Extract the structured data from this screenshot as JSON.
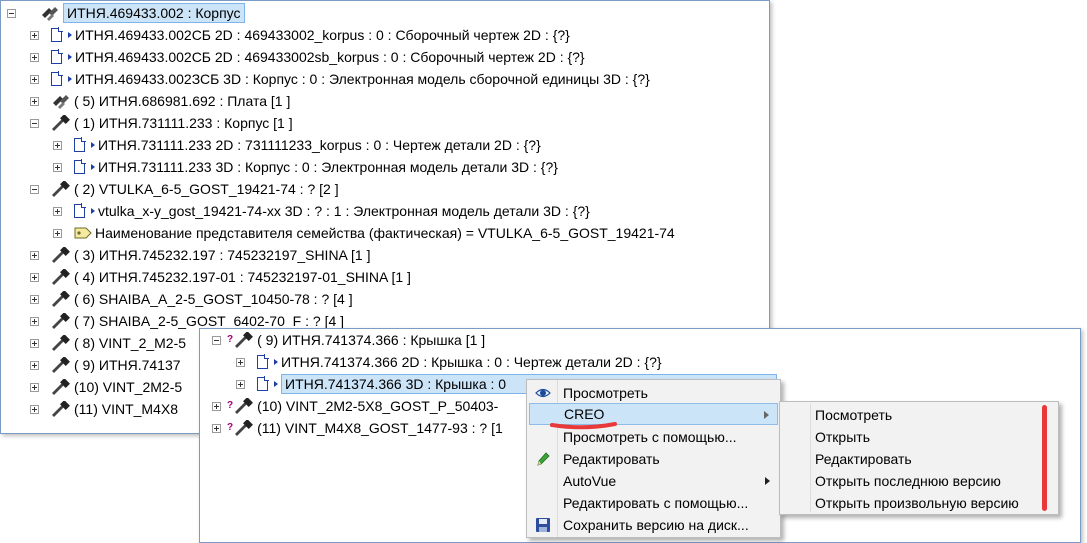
{
  "tree_main": {
    "rows": [
      {
        "text": "ИТНЯ.469433.002 : Корпус"
      },
      {
        "text": "ИТНЯ.469433.002СБ 2D : 469433002_korpus : 0 : Сборочный чертеж 2D : {?}"
      },
      {
        "text": "ИТНЯ.469433.002СБ 2D : 469433002sb_korpus : 0 : Сборочный чертеж 2D : {?}"
      },
      {
        "text": "ИТНЯ.469433.002ЗСБ 3D : Корпус : 0 : Электронная модель сборочной единицы 3D : {?}"
      },
      {
        "text": "( 5) ИТНЯ.686981.692 : Плата [1 ]"
      },
      {
        "text": "( 1) ИТНЯ.731111.233 : Корпус [1 ]"
      },
      {
        "text": "ИТНЯ.731111.233 2D : 731111233_korpus : 0 : Чертеж детали 2D : {?}"
      },
      {
        "text": "ИТНЯ.731111.233 3D : Корпус : 0 : Электронная модель детали 3D : {?}"
      },
      {
        "text": "( 2) VTULKA_6-5_GOST_19421-74 : ? [2 ]"
      },
      {
        "text": "vtulka_x-y_gost_19421-74-xx 3D : ? : 1 : Электронная модель детали 3D : {?}"
      },
      {
        "text": "Наименование представителя семейства (фактическая) = VTULKA_6-5_GOST_19421-74"
      },
      {
        "text": "( 3) ИТНЯ.745232.197 : 745232197_SHINA [1 ]"
      },
      {
        "text": "( 4) ИТНЯ.745232.197-01 : 745232197-01_SHINA [1 ]"
      },
      {
        "text": "( 6) SHAIBA_A_2-5_GOST_10450-78 : ? [4 ]"
      },
      {
        "text": "( 7) SHAIBA_2-5_GOST_6402-70_F : ? [4 ]"
      },
      {
        "text": "( 8) VINT_2_M2-5"
      },
      {
        "text": "( 9) ИТНЯ.74137"
      },
      {
        "text": "(10) VINT_2M2-5"
      },
      {
        "text": "(11) VINT_M4X8"
      }
    ]
  },
  "tree_overlay": {
    "rows": [
      {
        "text": "( 9) ИТНЯ.741374.366 : Крышка [1 ]"
      },
      {
        "text": "ИТНЯ.741374.366 2D : Крышка : 0 : Чертеж детали 2D : {?}"
      },
      {
        "text": "ИТНЯ.741374.366 3D : Крышка : 0"
      },
      {
        "text": "(10) VINT_2M2-5X8_GOST_P_50403-"
      },
      {
        "text": "(11) VINT_M4X8_GOST_1477-93 : ? [1"
      }
    ]
  },
  "context_menu": {
    "items": [
      {
        "label": "Просмотреть",
        "icon": "eye-icon"
      },
      {
        "label": "CREO",
        "icon": "",
        "submenu": true,
        "highlighted": true
      },
      {
        "label": "Просмотреть с помощью...",
        "icon": ""
      },
      {
        "label": "Редактировать",
        "icon": "pencil-icon"
      },
      {
        "label": "AutoVue",
        "icon": "",
        "submenu": true
      },
      {
        "label": "Редактировать с помощью...",
        "icon": ""
      },
      {
        "label": "Сохранить версию на диск...",
        "icon": "floppy-disk-icon"
      }
    ]
  },
  "submenu": {
    "items": [
      {
        "label": "Посмотреть"
      },
      {
        "label": "Открыть"
      },
      {
        "label": "Редактировать"
      },
      {
        "label": "Открыть последнюю версию"
      },
      {
        "label": "Открыть произвольную версию"
      }
    ]
  },
  "colors": {
    "accent_red": "#e8383a",
    "selection": "#cce4f7",
    "doc_icon": "#1f3fa6"
  }
}
